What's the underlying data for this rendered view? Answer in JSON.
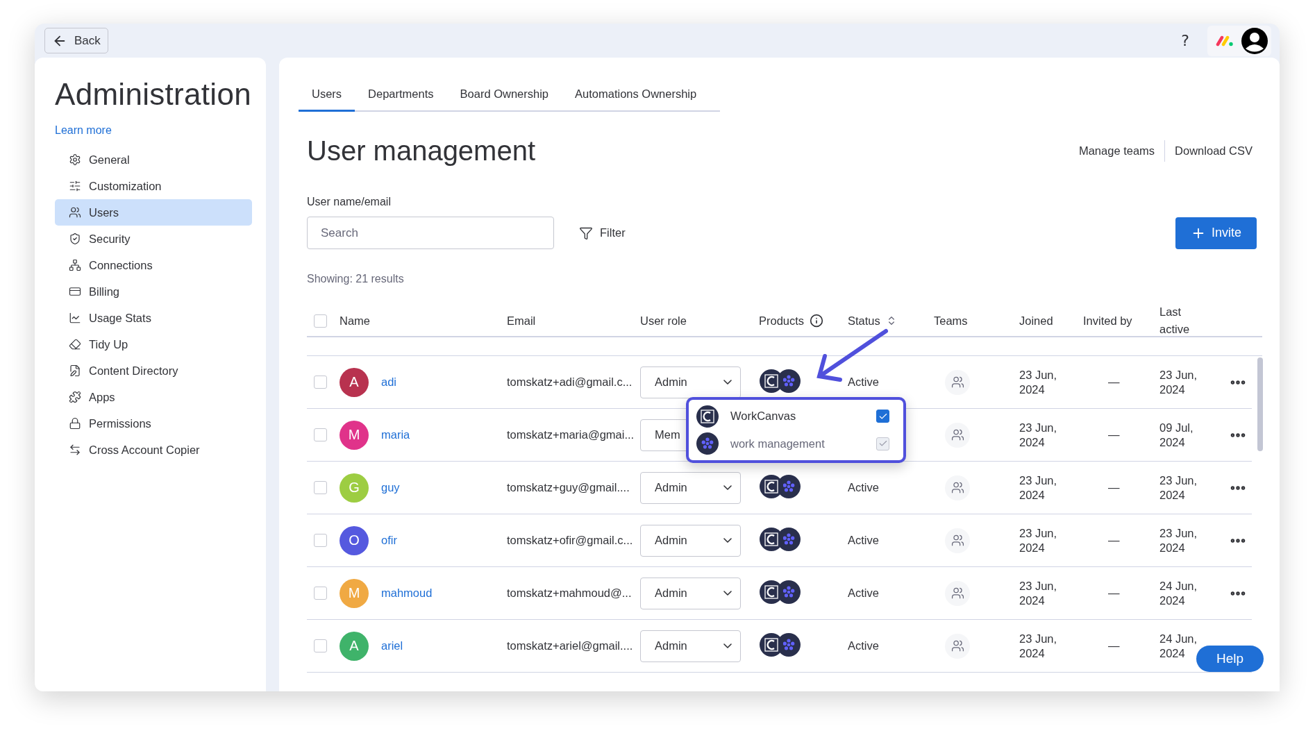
{
  "top_bar": {
    "back": "Back",
    "help": "?"
  },
  "sidebar": {
    "title": "Administration",
    "link": "Learn more",
    "items": [
      {
        "label": "General",
        "selected": false
      },
      {
        "label": "Customization",
        "selected": false
      },
      {
        "label": "Users",
        "selected": true
      },
      {
        "label": "Security",
        "selected": false
      },
      {
        "label": "Connections",
        "selected": false
      },
      {
        "label": "Billing",
        "selected": false
      },
      {
        "label": "Usage Stats",
        "selected": false
      },
      {
        "label": "Tidy Up",
        "selected": false
      },
      {
        "label": "Content Directory",
        "selected": false
      },
      {
        "label": "Apps",
        "selected": false
      },
      {
        "label": "Permissions",
        "selected": false
      },
      {
        "label": "Cross Account Copier",
        "selected": false
      }
    ]
  },
  "tabs": [
    {
      "label": "Users",
      "selected": true
    },
    {
      "label": "Departments",
      "selected": false
    },
    {
      "label": "Board Ownership",
      "selected": false
    },
    {
      "label": "Automations Ownership",
      "selected": false
    }
  ],
  "page": {
    "title": "User management",
    "actions": [
      "Manage teams",
      "Download CSV"
    ],
    "search_label": "User name/email",
    "search": {
      "placeholder": "Search"
    },
    "filter": "Filter",
    "invite": "Invite",
    "results": "Showing: 21 results"
  },
  "table": {
    "select_all": {
      "checked": false
    },
    "columns": [
      "Name",
      "Email",
      "User role",
      "Products",
      "Status",
      "Teams",
      "Joined",
      "Invited by",
      "Last active"
    ],
    "rows": [
      {
        "initial": "A",
        "color": "#b8324f",
        "name": "adi",
        "email": "tomskatz+adi@gmail.c...",
        "role": "Admin",
        "status": "Active",
        "joined": "23 Jun, 2024",
        "invited_by": "—",
        "last_active": "23 Jun, 2024",
        "checked": false
      },
      {
        "initial": "M",
        "color": "#e0338a",
        "name": "maria",
        "email": "tomskatz+maria@gmai...",
        "role": "Mem",
        "joined": "23 Jun, 2024",
        "invited_by": "—",
        "last_active": "09 Jul, 2024",
        "checked": false
      },
      {
        "initial": "G",
        "color": "#9dcd42",
        "name": "guy",
        "email": "tomskatz+guy@gmail....",
        "role": "Admin",
        "status": "Active",
        "joined": "23 Jun, 2024",
        "invited_by": "—",
        "last_active": "23 Jun, 2024",
        "checked": false
      },
      {
        "initial": "O",
        "color": "#5559df",
        "name": "ofir",
        "email": "tomskatz+ofir@gmail.c...",
        "role": "Admin",
        "status": "Active",
        "joined": "23 Jun, 2024",
        "invited_by": "—",
        "last_active": "23 Jun, 2024",
        "checked": false
      },
      {
        "initial": "M",
        "color": "#f0a943",
        "name": "mahmoud",
        "email": "tomskatz+mahmoud@...",
        "role": "Admin",
        "status": "Active",
        "joined": "23 Jun, 2024",
        "invited_by": "—",
        "last_active": "24 Jun, 2024",
        "checked": false
      },
      {
        "initial": "A",
        "color": "#3fb36a",
        "name": "ariel",
        "email": "tomskatz+ariel@gmail....",
        "role": "Admin",
        "status": "Active",
        "joined": "23 Jun, 2024",
        "invited_by": "—",
        "last_active": "24 Jun, 2024",
        "checked": false
      }
    ]
  },
  "popup": {
    "items": [
      {
        "label": "WorkCanvas",
        "checked": true,
        "disabled": false
      },
      {
        "label": "work management",
        "checked": true,
        "disabled": true
      }
    ]
  },
  "help": "Help"
}
